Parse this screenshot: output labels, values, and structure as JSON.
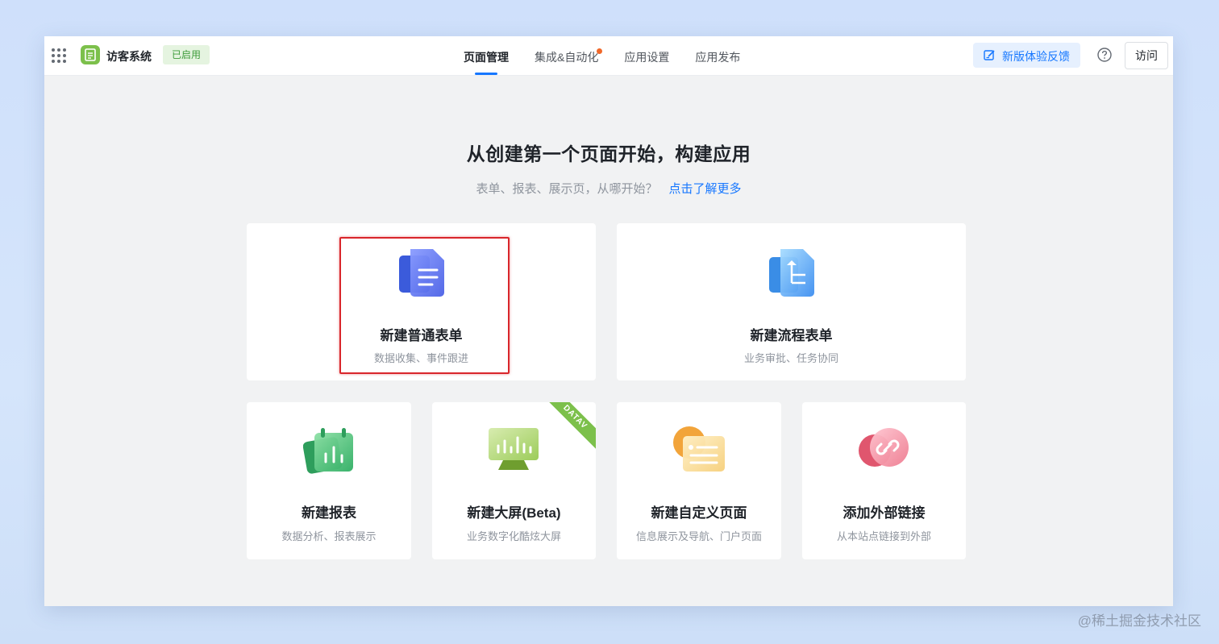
{
  "app": {
    "name": "访客系统",
    "status": "已启用"
  },
  "nav": [
    {
      "label": "页面管理",
      "active": true
    },
    {
      "label": "集成&自动化",
      "dot": true
    },
    {
      "label": "应用设置"
    },
    {
      "label": "应用发布"
    }
  ],
  "header": {
    "feedback_label": "新版体验反馈",
    "visit_label": "访问"
  },
  "main": {
    "heading": "从创建第一个页面开始，构建应用",
    "subheading": "表单、报表、展示页，从哪开始？",
    "learn_more": "点击了解更多"
  },
  "cards": {
    "form": {
      "title": "新建普通表单",
      "desc": "数据收集、事件跟进",
      "icon": "document-icon"
    },
    "flow": {
      "title": "新建流程表单",
      "desc": "业务审批、任务协同",
      "icon": "workflow-icon"
    },
    "report": {
      "title": "新建报表",
      "desc": "数据分析、报表展示",
      "icon": "report-chart-icon"
    },
    "screen": {
      "title": "新建大屏(Beta)",
      "desc": "业务数字化酷炫大屏",
      "icon": "monitor-chart-icon",
      "ribbon": "DATAV"
    },
    "custom": {
      "title": "新建自定义页面",
      "desc": "信息展示及导航、门户页面",
      "icon": "custom-page-icon"
    },
    "link": {
      "title": "添加外部链接",
      "desc": "从本站点链接到外部",
      "icon": "link-icon"
    }
  },
  "colors": {
    "accent": "#1677ff",
    "highlight": "#d9262b",
    "badge_green": "#3d9b3a"
  },
  "watermark": "@稀土掘金技术社区"
}
